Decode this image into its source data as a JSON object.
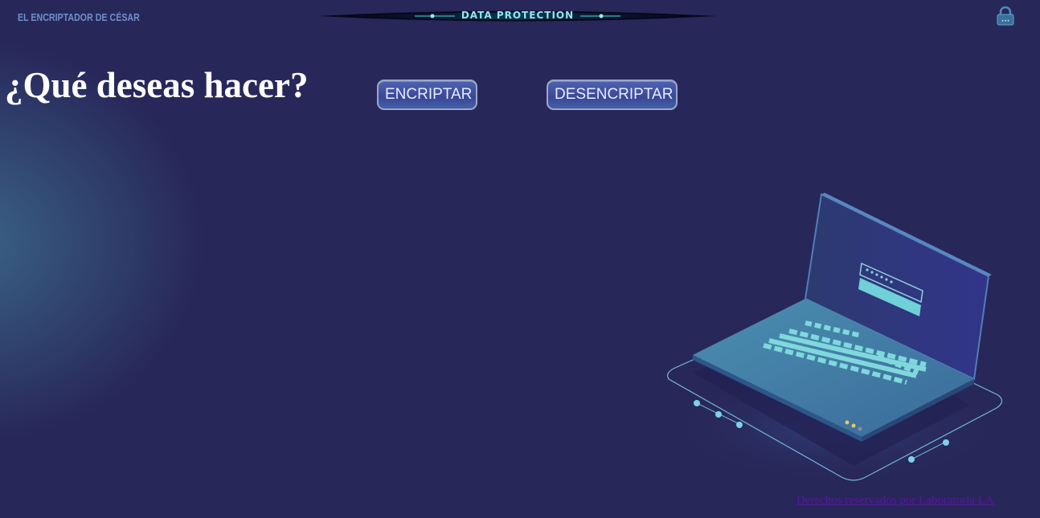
{
  "header": {
    "brand": "EL ENCRIPTADOR DE CÉSAR",
    "banner_text": "DATA PROTECTION",
    "lock_icon": "lock-icon"
  },
  "main": {
    "heading": "¿Qué deseas hacer?",
    "encrypt_label": "ENCRIPTAR",
    "decrypt_label": "DESENCRIPTAR",
    "illustration": "laptop-login-illustration"
  },
  "footer": {
    "link_text": "Derechos reservados por Laboratoria LA"
  },
  "colors": {
    "background": "#28275a",
    "heading": "#ffffff",
    "button": "#4a5aa8",
    "accent": "#6fd0d8",
    "footer_link": "#55199a"
  }
}
